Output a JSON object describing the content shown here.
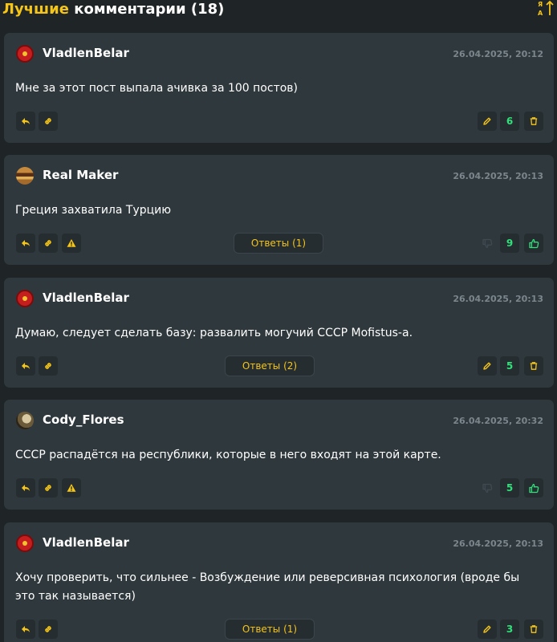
{
  "header": {
    "title_accent": "Лучшие",
    "title_rest": " комментарии (18)",
    "sort_icon": "sort-alpha-icon"
  },
  "colors": {
    "background": "#1f2427",
    "card": "#2f383d",
    "accent": "#f5c518",
    "score": "#31e07a",
    "muted": "#7b868c"
  },
  "comments": [
    {
      "author": "VladlenBelar",
      "date": "26.04.2025, 20:12",
      "text": "Мне за этот пост выпала ачивка за 100 постов)",
      "score": "6"
    },
    {
      "author": "Real Maker",
      "date": "26.04.2025, 20:13",
      "text": "Греция захватила Турцию",
      "score": "9",
      "answers": "Ответы (1)"
    },
    {
      "author": "VladlenBelar",
      "date": "26.04.2025, 20:13",
      "text": "Думаю, следует сделать базу: развалить могучий СССР Mofistus-a.",
      "score": "5",
      "answers": "Ответы (2)"
    },
    {
      "author": "Cody_Flores",
      "date": "26.04.2025, 20:32",
      "text": "СССР распадётся на республики, которые в него входят на этой карте.",
      "score": "5"
    },
    {
      "author": "VladlenBelar",
      "date": "26.04.2025, 20:13",
      "text": "Хочу проверить, что сильнее - Возбуждение или реверсивная психология (вроде бы это так называется)",
      "score": "3",
      "answers": "Ответы (1)"
    }
  ]
}
